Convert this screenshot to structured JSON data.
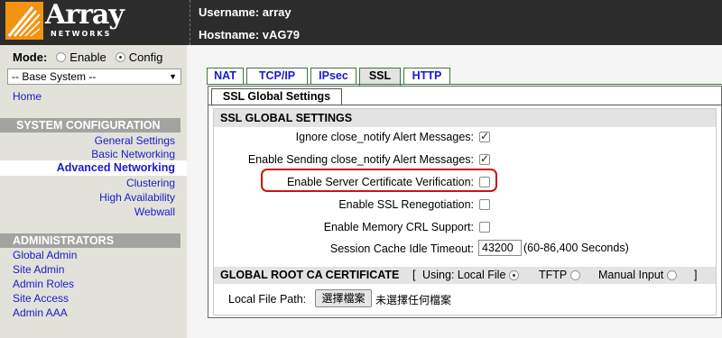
{
  "header": {
    "logo_word": "Array",
    "logo_sub": "NETWORKS",
    "username_line": "Username: array",
    "hostname_line": "Hostname: vAG79"
  },
  "sidebar": {
    "mode_label": "Mode:",
    "mode_options": [
      "Enable",
      "Config"
    ],
    "mode_selected": "Config",
    "base_select": "-- Base System --",
    "home": "Home",
    "system_config_header": "SYSTEM CONFIGURATION",
    "system_items": [
      "General Settings",
      "Basic Networking",
      "Advanced Networking",
      "Clustering",
      "High Availability",
      "Webwall"
    ],
    "selected_item": "Advanced Networking",
    "administrators_header": "ADMINISTRATORS",
    "admin_items": [
      "Global Admin",
      "Site Admin",
      "Admin Roles",
      "Site Access",
      "Admin AAA"
    ]
  },
  "tabs": [
    "NAT",
    "TCP/IP",
    "IPsec",
    "SSL",
    "HTTP"
  ],
  "active_tab": "SSL",
  "subtab": "SSL Global Settings",
  "ssl_settings": {
    "header": "SSL GLOBAL SETTINGS",
    "options": [
      {
        "label": "Ignore close_notify Alert Messages:",
        "checked": true
      },
      {
        "label": "Enable Sending close_notify Alert Messages:",
        "checked": true
      },
      {
        "label": "Enable Server Certificate Verification:",
        "checked": false,
        "highlighted": true
      },
      {
        "label": "Enable SSL Renegotiation:",
        "checked": false
      },
      {
        "label": "Enable Memory CRL Support:",
        "checked": false
      }
    ],
    "timeout_label": "Session Cache Idle Timeout:",
    "timeout_value": "43200",
    "timeout_range": "(60-86,400 Seconds)"
  },
  "root_ca": {
    "header": "GLOBAL ROOT CA CERTIFICATE",
    "open_bracket": "[",
    "options": [
      "Using: Local File",
      "TFTP",
      "Manual Input"
    ],
    "selected": "Using: Local File",
    "close_bracket": "]",
    "local_file_label": "Local File Path:",
    "file_button": "選擇檔案",
    "file_status": "未選擇任何檔案"
  },
  "colors": {
    "header_bg": "#2c2c2c",
    "logo_orange": "#f29412",
    "sidebar_bg": "#e2e2da",
    "link": "#1a1acc",
    "tab_border": "#3b7a3b",
    "highlight": "#d01010"
  }
}
